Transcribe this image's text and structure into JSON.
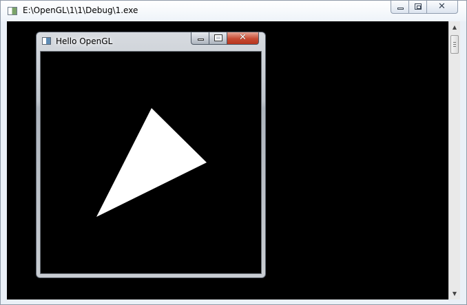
{
  "console": {
    "title": "E:\\OpenGL\\1\\1\\Debug\\1.exe",
    "background_color": "#000000",
    "icons": {
      "app": "console-app-icon",
      "minimize": "minimize-icon",
      "maximize": "maximize-icon",
      "close": "close-icon",
      "scroll_up": "arrow-up-icon",
      "scroll_down": "arrow-down-icon"
    },
    "scroll_up_glyph": "▲",
    "scroll_down_glyph": "▼",
    "close_glyph": "✕"
  },
  "gl_window": {
    "title": "Hello OpenGL",
    "close_glyph": "✕",
    "close_color": "#c64a32",
    "icons": {
      "app": "window-app-icon",
      "minimize": "minimize-icon",
      "maximize": "maximize-icon",
      "close": "close-icon"
    },
    "triangle_color": "#ffffff"
  }
}
